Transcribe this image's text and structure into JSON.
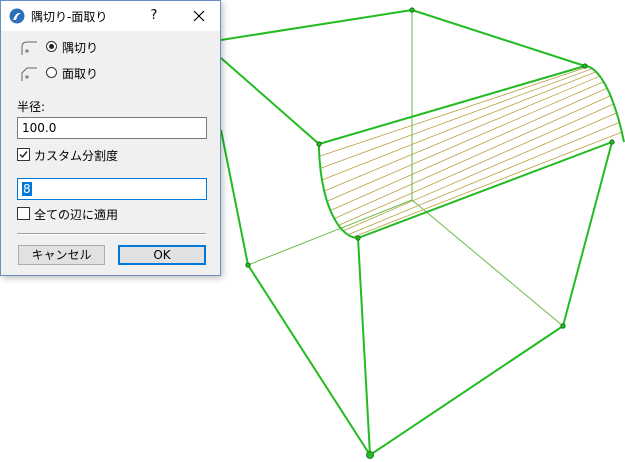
{
  "dialog": {
    "title": "隅切り-面取り",
    "help_label": "?",
    "modes": [
      {
        "label": "隅切り",
        "icon": "fillet-corner-icon",
        "selected": true
      },
      {
        "label": "面取り",
        "icon": "chamfer-corner-icon",
        "selected": false
      }
    ],
    "radius_label": "半径:",
    "radius_value": "100.0",
    "custom_segments_label": "カスタム分割度",
    "custom_segments_checked": true,
    "segments_value": "8",
    "apply_all_edges_label": "全ての辺に適用",
    "apply_all_edges_checked": false,
    "cancel_label": "キャンセル",
    "ok_label": "OK"
  },
  "viewport": {
    "edge_color": "#22bb22",
    "hidden_edge_color": "#66bb44",
    "fillet_line_color": "#b8a040"
  }
}
